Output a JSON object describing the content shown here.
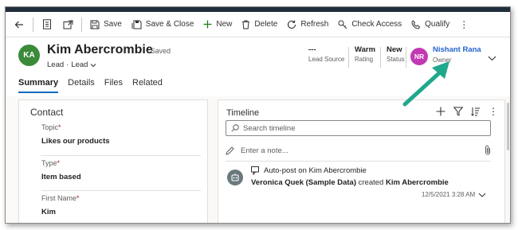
{
  "toolbar": {
    "back_icon": "back-arrow-icon",
    "items": [
      {
        "label": "Save",
        "icon": "save-icon"
      },
      {
        "label": "Save & Close",
        "icon": "save-close-icon"
      },
      {
        "label": "New",
        "icon": "plus-icon"
      },
      {
        "label": "Delete",
        "icon": "trash-icon"
      },
      {
        "label": "Refresh",
        "icon": "refresh-icon"
      },
      {
        "label": "Check Access",
        "icon": "key-icon"
      },
      {
        "label": "Qualify",
        "icon": "phone-icon"
      }
    ],
    "more": "⋮"
  },
  "record": {
    "initials": "KA",
    "avatar_color": "#3a8a3a",
    "name": "Kim Abercrombie",
    "status": "- Saved",
    "entity": "Lead",
    "sep": "·",
    "form": "Lead"
  },
  "header_fields": [
    {
      "value": "---",
      "label": "Lead Source"
    },
    {
      "value": "Warm",
      "label": "Rating"
    },
    {
      "value": "New",
      "label": "Status"
    }
  ],
  "owner": {
    "initials": "NR",
    "avatar_color": "#c239b3",
    "name": "Nishant Rana",
    "label": "Owner"
  },
  "tabs": [
    "Summary",
    "Details",
    "Files",
    "Related"
  ],
  "contact": {
    "title": "Contact",
    "fields": [
      {
        "label": "Topic",
        "required": "*",
        "value": "Likes our products"
      },
      {
        "label": "Type",
        "required": "*",
        "value": "Item based"
      },
      {
        "label": "First Name",
        "required": "*",
        "value": "Kim"
      }
    ]
  },
  "timeline": {
    "title": "Timeline",
    "search_placeholder": "Search timeline",
    "note_placeholder": "Enter a note...",
    "post": {
      "title": "Auto-post on Kim Abercrombie",
      "author": "Veronica Quek (Sample Data)",
      "verb": "created",
      "subject": "Kim Abercrombie",
      "date": "12/5/2021 3:28 AM"
    }
  },
  "colors": {
    "accent": "#0f6cbd",
    "owner_link": "#2564cf",
    "annotation_arrow": "#1fa88c"
  }
}
